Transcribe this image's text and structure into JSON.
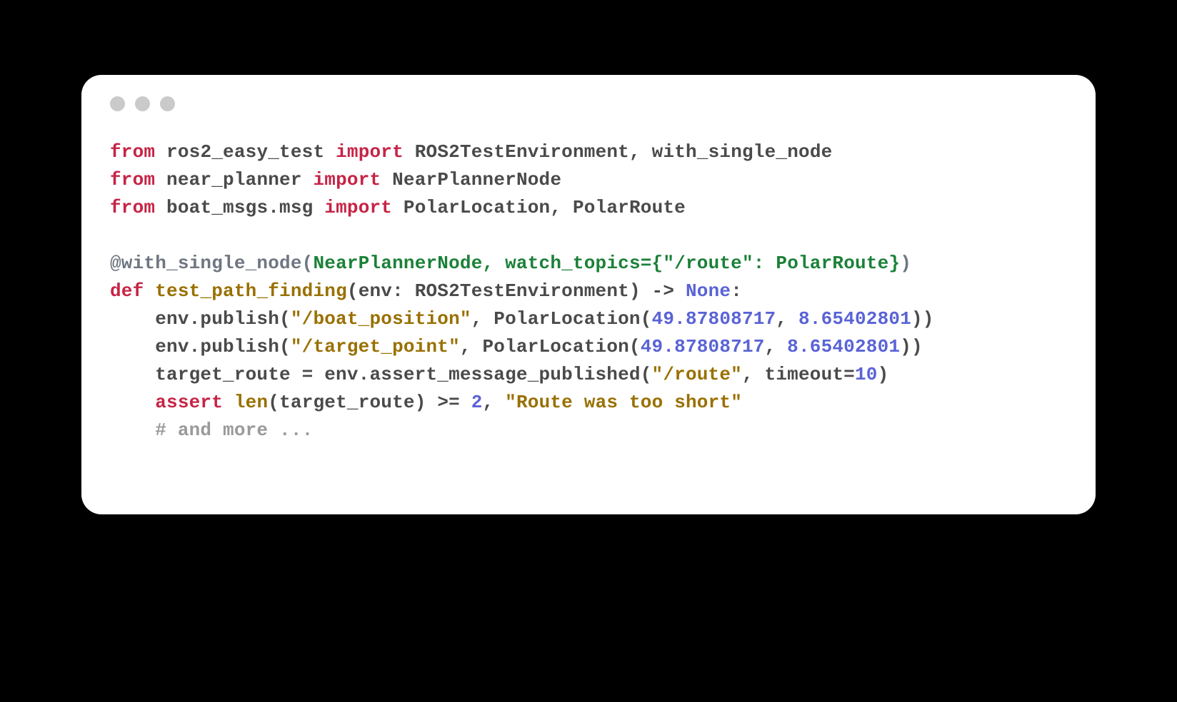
{
  "code": {
    "l1": {
      "from": "from",
      "mod": "ros2_easy_test",
      "imp": "import",
      "names": "ROS2TestEnvironment, with_single_node"
    },
    "l2": {
      "from": "from",
      "mod": "near_planner",
      "imp": "import",
      "names": "NearPlannerNode"
    },
    "l3": {
      "from": "from",
      "mod": "boat_msgs.msg",
      "imp": "import",
      "names": "PolarLocation, PolarRoute"
    },
    "l5": {
      "at": "@with_single_node",
      "lpar": "(",
      "args_a": "NearPlannerNode, watch_topics={",
      "str": "\"/route\"",
      "args_b": ": PolarRoute}",
      "rpar": ")"
    },
    "l6": {
      "def": "def",
      "name": "test_path_finding",
      "sig": "(env: ROS2TestEnvironment) -> ",
      "none": "None",
      "colon": ":"
    },
    "l7": {
      "pre": "    env.publish(",
      "str": "\"/boat_position\"",
      "mid": ", PolarLocation(",
      "n1": "49.87808717",
      "comma": ", ",
      "n2": "8.65402801",
      "post": "))"
    },
    "l8": {
      "pre": "    env.publish(",
      "str": "\"/target_point\"",
      "mid": ", PolarLocation(",
      "n1": "49.87808717",
      "comma": ", ",
      "n2": "8.65402801",
      "post": "))"
    },
    "l9": {
      "pre": "    target_route = env.assert_message_published(",
      "str": "\"/route\"",
      "mid": ", timeout=",
      "n": "10",
      "post": ")"
    },
    "l10": {
      "indent": "    ",
      "assert": "assert",
      "sp": " ",
      "len": "len",
      "args": "(target_route) >= ",
      "n": "2",
      "comma": ", ",
      "msg": "\"Route was too short\""
    },
    "l11": {
      "comment": "    # and more ..."
    }
  }
}
